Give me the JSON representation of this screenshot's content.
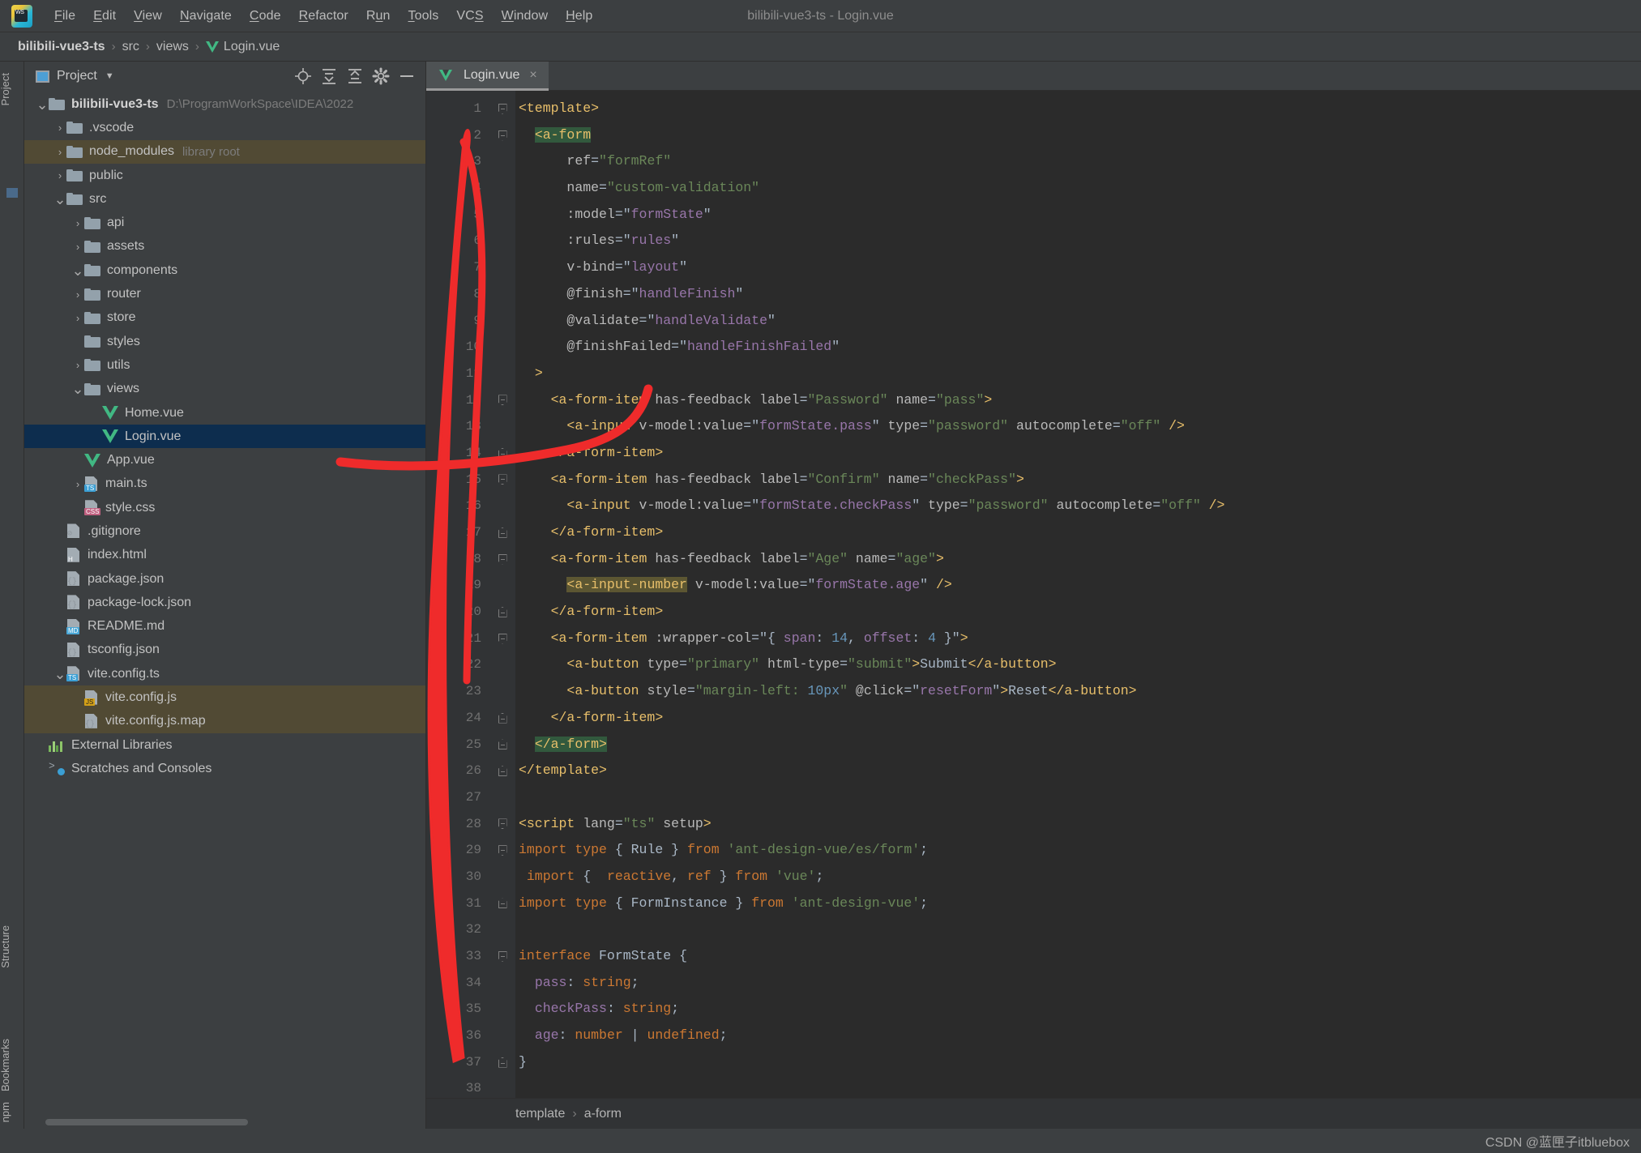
{
  "window": {
    "title": "bilibili-vue3-ts - Login.vue",
    "app_icon": "webstorm-logo-icon"
  },
  "menubar": {
    "items": [
      {
        "label": "File",
        "mnemonic": "F"
      },
      {
        "label": "Edit",
        "mnemonic": "E"
      },
      {
        "label": "View",
        "mnemonic": "V"
      },
      {
        "label": "Navigate",
        "mnemonic": "N"
      },
      {
        "label": "Code",
        "mnemonic": "C"
      },
      {
        "label": "Refactor",
        "mnemonic": "R"
      },
      {
        "label": "Run",
        "mnemonic": "u"
      },
      {
        "label": "Tools",
        "mnemonic": "T"
      },
      {
        "label": "VCS",
        "mnemonic": "S"
      },
      {
        "label": "Window",
        "mnemonic": "W"
      },
      {
        "label": "Help",
        "mnemonic": "H"
      }
    ]
  },
  "breadcrumb": {
    "items": [
      "bilibili-vue3-ts",
      "src",
      "views",
      "Login.vue"
    ]
  },
  "tool_stripe": {
    "project": "Project",
    "structure": "Structure",
    "bookmarks": "Bookmarks",
    "npm": "npm"
  },
  "project_panel": {
    "title": "Project",
    "actions": [
      "locate-icon",
      "expand-all-icon",
      "collapse-all-icon",
      "settings-gear-icon",
      "hide-icon"
    ],
    "tree": [
      {
        "label": "bilibili-vue3-ts",
        "dim": "D:\\ProgramWorkSpace\\IDEA\\2022",
        "indent": 0,
        "arrow": "down",
        "icon": "folder",
        "bold": true,
        "state": "none"
      },
      {
        "label": ".vscode",
        "dim": "",
        "indent": 1,
        "arrow": "right",
        "icon": "folder",
        "bold": false,
        "state": "none"
      },
      {
        "label": "node_modules",
        "dim": "library root",
        "indent": 1,
        "arrow": "right",
        "icon": "folder",
        "bold": false,
        "state": "brown"
      },
      {
        "label": "public",
        "dim": "",
        "indent": 1,
        "arrow": "right",
        "icon": "folder",
        "bold": false,
        "state": "none"
      },
      {
        "label": "src",
        "dim": "",
        "indent": 1,
        "arrow": "down",
        "icon": "folder",
        "bold": false,
        "state": "none"
      },
      {
        "label": "api",
        "dim": "",
        "indent": 2,
        "arrow": "right",
        "icon": "folder",
        "bold": false,
        "state": "none"
      },
      {
        "label": "assets",
        "dim": "",
        "indent": 2,
        "arrow": "right",
        "icon": "folder",
        "bold": false,
        "state": "none"
      },
      {
        "label": "components",
        "dim": "",
        "indent": 2,
        "arrow": "down",
        "icon": "folder",
        "bold": false,
        "state": "none"
      },
      {
        "label": "router",
        "dim": "",
        "indent": 2,
        "arrow": "right",
        "icon": "folder",
        "bold": false,
        "state": "none"
      },
      {
        "label": "store",
        "dim": "",
        "indent": 2,
        "arrow": "right",
        "icon": "folder",
        "bold": false,
        "state": "none"
      },
      {
        "label": "styles",
        "dim": "",
        "indent": 2,
        "arrow": "none",
        "icon": "folder",
        "bold": false,
        "state": "none"
      },
      {
        "label": "utils",
        "dim": "",
        "indent": 2,
        "arrow": "right",
        "icon": "folder",
        "bold": false,
        "state": "none"
      },
      {
        "label": "views",
        "dim": "",
        "indent": 2,
        "arrow": "down",
        "icon": "folder",
        "bold": false,
        "state": "none"
      },
      {
        "label": "Home.vue",
        "dim": "",
        "indent": 3,
        "arrow": "none",
        "icon": "vue",
        "bold": false,
        "state": "none"
      },
      {
        "label": "Login.vue",
        "dim": "",
        "indent": 3,
        "arrow": "none",
        "icon": "vue",
        "bold": false,
        "state": "blue"
      },
      {
        "label": "App.vue",
        "dim": "",
        "indent": 2,
        "arrow": "none",
        "icon": "vue",
        "bold": false,
        "state": "none"
      },
      {
        "label": "main.ts",
        "dim": "",
        "indent": 2,
        "arrow": "right",
        "icon": "ts",
        "bold": false,
        "state": "none"
      },
      {
        "label": "style.css",
        "dim": "",
        "indent": 2,
        "arrow": "none",
        "icon": "css",
        "bold": false,
        "state": "none"
      },
      {
        "label": ".gitignore",
        "dim": "",
        "indent": 1,
        "arrow": "none",
        "icon": "gitignore",
        "bold": false,
        "state": "none"
      },
      {
        "label": "index.html",
        "dim": "",
        "indent": 1,
        "arrow": "none",
        "icon": "html",
        "bold": false,
        "state": "none"
      },
      {
        "label": "package.json",
        "dim": "",
        "indent": 1,
        "arrow": "none",
        "icon": "json",
        "bold": false,
        "state": "none"
      },
      {
        "label": "package-lock.json",
        "dim": "",
        "indent": 1,
        "arrow": "none",
        "icon": "json",
        "bold": false,
        "state": "none"
      },
      {
        "label": "README.md",
        "dim": "",
        "indent": 1,
        "arrow": "none",
        "icon": "md",
        "bold": false,
        "state": "none"
      },
      {
        "label": "tsconfig.json",
        "dim": "",
        "indent": 1,
        "arrow": "none",
        "icon": "json",
        "bold": false,
        "state": "none"
      },
      {
        "label": "vite.config.ts",
        "dim": "",
        "indent": 1,
        "arrow": "down",
        "icon": "ts",
        "bold": false,
        "state": "none"
      },
      {
        "label": "vite.config.js",
        "dim": "",
        "indent": 2,
        "arrow": "none",
        "icon": "js",
        "bold": false,
        "state": "brown"
      },
      {
        "label": "vite.config.js.map",
        "dim": "",
        "indent": 2,
        "arrow": "none",
        "icon": "jsmap",
        "bold": false,
        "state": "brown"
      },
      {
        "label": "External Libraries",
        "dim": "",
        "indent": 0,
        "arrow": "none",
        "icon": "library",
        "bold": false,
        "state": "none"
      },
      {
        "label": "Scratches and Consoles",
        "dim": "",
        "indent": 0,
        "arrow": "none",
        "icon": "scratch",
        "bold": false,
        "state": "none"
      }
    ]
  },
  "editor": {
    "tab": {
      "label": "Login.vue",
      "icon": "vue-file-icon",
      "close": "×"
    },
    "first_line": 1,
    "last_line": 38,
    "lines": [
      {
        "n": 1,
        "fold": "open",
        "html": "<span class=\"tg\">&lt;template&gt;</span>"
      },
      {
        "n": 2,
        "fold": "open",
        "html": "  <span class=\"hl-a tg\">&lt;a-form</span>"
      },
      {
        "n": 3,
        "fold": "",
        "html": "      <span class=\"at\">ref</span><span class=\"pl\">=</span><span class=\"st\">\"formRef\"</span>"
      },
      {
        "n": 4,
        "fold": "",
        "html": "      <span class=\"at\">name</span><span class=\"pl\">=</span><span class=\"st\">\"custom-validation\"</span>"
      },
      {
        "n": 5,
        "fold": "",
        "html": "      <span class=\"at\">:model</span><span class=\"pl\">=</span><span class=\"pl\">\"</span><span class=\"atd\">formState</span><span class=\"pl\">\"</span>"
      },
      {
        "n": 6,
        "fold": "",
        "html": "      <span class=\"at\">:rules</span><span class=\"pl\">=</span><span class=\"pl\">\"</span><span class=\"atd\">rules</span><span class=\"pl\">\"</span>"
      },
      {
        "n": 7,
        "fold": "",
        "html": "      <span class=\"at\">v-bind</span><span class=\"pl\">=</span><span class=\"pl\">\"</span><span class=\"atd\">layout</span><span class=\"pl\">\"</span>"
      },
      {
        "n": 8,
        "fold": "",
        "html": "      <span class=\"at\">@finish</span><span class=\"pl\">=</span><span class=\"pl\">\"</span><span class=\"atd\">handleFinish</span><span class=\"pl\">\"</span>"
      },
      {
        "n": 9,
        "fold": "",
        "html": "      <span class=\"at\">@validate</span><span class=\"pl\">=</span><span class=\"pl\">\"</span><span class=\"atd\">handleValidate</span><span class=\"pl\">\"</span>"
      },
      {
        "n": 10,
        "fold": "",
        "html": "      <span class=\"at\">@finishFailed</span><span class=\"pl\">=</span><span class=\"pl\">\"</span><span class=\"atd\">handleFinishFailed</span><span class=\"pl\">\"</span>"
      },
      {
        "n": 11,
        "fold": "",
        "html": "  <span class=\"tg\">&gt;</span>"
      },
      {
        "n": 12,
        "fold": "open",
        "html": "    <span class=\"tg\">&lt;a-form-item</span> <span class=\"at\">has-feedback</span> <span class=\"at\">label</span><span class=\"pl\">=</span><span class=\"st\">\"Password\"</span> <span class=\"at\">name</span><span class=\"pl\">=</span><span class=\"st\">\"pass\"</span><span class=\"tg\">&gt;</span>"
      },
      {
        "n": 13,
        "fold": "",
        "html": "      <span class=\"tg\">&lt;a-input</span> <span class=\"at\">v-model:value</span><span class=\"pl\">=</span><span class=\"pl\">\"</span><span class=\"atd\">formState.pass</span><span class=\"pl\">\"</span> <span class=\"at\">type</span><span class=\"pl\">=</span><span class=\"st\">\"password\"</span> <span class=\"at\">autocomplete</span><span class=\"pl\">=</span><span class=\"st\">\"off\"</span> <span class=\"tg\">/&gt;</span>"
      },
      {
        "n": 14,
        "fold": "close",
        "html": "    <span class=\"tg\">&lt;/a-form-item&gt;</span>"
      },
      {
        "n": 15,
        "fold": "open",
        "html": "    <span class=\"tg\">&lt;a-form-item</span> <span class=\"at\">has-feedback</span> <span class=\"at\">label</span><span class=\"pl\">=</span><span class=\"st\">\"Confirm\"</span> <span class=\"at\">name</span><span class=\"pl\">=</span><span class=\"st\">\"checkPass\"</span><span class=\"tg\">&gt;</span>"
      },
      {
        "n": 16,
        "fold": "",
        "html": "      <span class=\"tg\">&lt;a-input</span> <span class=\"at\">v-model:value</span><span class=\"pl\">=</span><span class=\"pl\">\"</span><span class=\"atd\">formState.checkPass</span><span class=\"pl\">\"</span> <span class=\"at\">type</span><span class=\"pl\">=</span><span class=\"st\">\"password\"</span> <span class=\"at\">autocomplete</span><span class=\"pl\">=</span><span class=\"st\">\"off\"</span> <span class=\"tg\">/&gt;</span>"
      },
      {
        "n": 17,
        "fold": "close",
        "html": "    <span class=\"tg\">&lt;/a-form-item&gt;</span>"
      },
      {
        "n": 18,
        "fold": "open",
        "html": "    <span class=\"tg\">&lt;a-form-item</span> <span class=\"at\">has-feedback</span> <span class=\"at\">label</span><span class=\"pl\">=</span><span class=\"st\">\"Age\"</span> <span class=\"at\">name</span><span class=\"pl\">=</span><span class=\"st\">\"age\"</span><span class=\"tg\">&gt;</span>"
      },
      {
        "n": 19,
        "fold": "",
        "html": "      <span class=\"hl-b tg\">&lt;a-input-number</span> <span class=\"at\">v-model:value</span><span class=\"pl\">=</span><span class=\"pl\">\"</span><span class=\"atd\">formState.age</span><span class=\"pl\">\"</span> <span class=\"tg\">/&gt;</span>"
      },
      {
        "n": 20,
        "fold": "close",
        "html": "    <span class=\"tg\">&lt;/a-form-item&gt;</span>"
      },
      {
        "n": 21,
        "fold": "open",
        "html": "    <span class=\"tg\">&lt;a-form-item</span> <span class=\"at\">:wrapper-col</span><span class=\"pl\">=</span><span class=\"pl\">\"{ </span><span class=\"atd\">span</span><span class=\"pl\">: </span><span class=\"num\">14</span><span class=\"pl\">, </span><span class=\"atd\">offset</span><span class=\"pl\">: </span><span class=\"num\">4</span><span class=\"pl\"> }\"</span><span class=\"tg\">&gt;</span>"
      },
      {
        "n": 22,
        "fold": "",
        "html": "      <span class=\"tg\">&lt;a-button</span> <span class=\"at\">type</span><span class=\"pl\">=</span><span class=\"st\">\"primary\"</span> <span class=\"at\">html-type</span><span class=\"pl\">=</span><span class=\"st\">\"submit\"</span><span class=\"tg\">&gt;</span><span class=\"txt\">Submit</span><span class=\"tg\">&lt;/a-button&gt;</span>"
      },
      {
        "n": 23,
        "fold": "",
        "html": "      <span class=\"tg\">&lt;a-button</span> <span class=\"at\">style</span><span class=\"pl\">=</span><span class=\"st\">\"margin-left: </span><span class=\"num\">10px</span><span class=\"st\">\"</span> <span class=\"at\">@click</span><span class=\"pl\">=</span><span class=\"pl\">\"</span><span class=\"atd\">resetForm</span><span class=\"pl\">\"</span><span class=\"tg\">&gt;</span><span class=\"txt\">Reset</span><span class=\"tg\">&lt;/a-button&gt;</span>"
      },
      {
        "n": 24,
        "fold": "close",
        "html": "    <span class=\"tg\">&lt;/a-form-item&gt;</span>"
      },
      {
        "n": 25,
        "fold": "close",
        "html": "  <span class=\"hl-a tg\">&lt;/a-form&gt;</span>"
      },
      {
        "n": 26,
        "fold": "close",
        "html": "<span class=\"tg\">&lt;/template&gt;</span>"
      },
      {
        "n": 27,
        "fold": "",
        "html": ""
      },
      {
        "n": 28,
        "fold": "open",
        "html": "<span class=\"tg\">&lt;script</span> <span class=\"at\">lang</span><span class=\"pl\">=</span><span class=\"st\">\"ts\"</span> <span class=\"at\">setup</span><span class=\"tg\">&gt;</span>"
      },
      {
        "n": 29,
        "fold": "open",
        "html": "<span class=\"kw\">import</span> <span class=\"kw\">type</span> <span class=\"pl\">{ </span><span class=\"cls\">Rule</span><span class=\"pl\"> } </span><span class=\"kw\">from</span> <span class=\"st\">'ant-design-vue/es/form'</span><span class=\"pl\">;</span>"
      },
      {
        "n": 30,
        "fold": "",
        "html": " <span class=\"kw\">import</span> <span class=\"pl\">{  </span><span class=\"kw\">reactive</span><span class=\"pl\">, </span><span class=\"kw\">ref</span><span class=\"pl\"> } </span><span class=\"kw\">from</span> <span class=\"st\">'vue'</span><span class=\"pl\">;</span>"
      },
      {
        "n": 31,
        "fold": "close",
        "html": "<span class=\"kw\">import</span> <span class=\"kw\">type</span> <span class=\"pl\">{ </span><span class=\"cls\">FormInstance</span><span class=\"pl\"> } </span><span class=\"kw\">from</span> <span class=\"st\">'ant-design-vue'</span><span class=\"pl\">;</span>"
      },
      {
        "n": 32,
        "fold": "",
        "html": ""
      },
      {
        "n": 33,
        "fold": "open",
        "html": "<span class=\"kw\">interface</span> <span class=\"cls\">FormState</span> <span class=\"pl\">{</span>"
      },
      {
        "n": 34,
        "fold": "",
        "html": "  <span class=\"atd\">pass</span><span class=\"pl\">: </span><span class=\"kw\">string</span><span class=\"pl\">;</span>"
      },
      {
        "n": 35,
        "fold": "",
        "html": "  <span class=\"atd\">checkPass</span><span class=\"pl\">: </span><span class=\"kw\">string</span><span class=\"pl\">;</span>"
      },
      {
        "n": 36,
        "fold": "",
        "html": "  <span class=\"atd\">age</span><span class=\"pl\">: </span><span class=\"kw\">number</span> <span class=\"pl\">| </span><span class=\"kw\">undefined</span><span class=\"pl\">;</span>"
      },
      {
        "n": 37,
        "fold": "close",
        "html": "<span class=\"pl\">}</span>"
      },
      {
        "n": 38,
        "fold": "",
        "html": ""
      }
    ]
  },
  "editor_breadcrumb": {
    "items": [
      "template",
      "a-form"
    ]
  },
  "status": {
    "watermark": "CSDN @蓝匣子itbluebox"
  },
  "annotation": {
    "color": "#ef2b2b",
    "shape": "hand-drawn-curve-pointing-to-login-vue"
  }
}
